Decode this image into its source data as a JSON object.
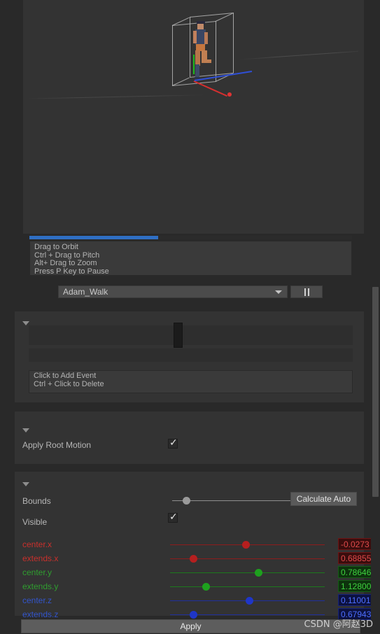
{
  "preview": {
    "hints": [
      "Drag to Orbit",
      "Ctrl + Drag to Pitch",
      "Alt+ Drag to Zoom",
      "Press P Key to Pause"
    ],
    "progress_percent": 40,
    "progress_color": "#2f6fc4"
  },
  "clip_selector": {
    "selected": "Adam_Walk",
    "play_pause_icon": "pause-icon"
  },
  "events": {
    "hints": [
      "Click to Add Event",
      "Ctrl + Click to Delete"
    ],
    "scrubber_percent": 46
  },
  "root_motion": {
    "label": "Apply Root Motion",
    "checked": true
  },
  "bounds": {
    "label": "Bounds",
    "slider_percent": 12,
    "calculate_auto_label": "Calculate Auto",
    "visible_label": "Visible",
    "visible_checked": true,
    "axes": [
      {
        "name": "center.x",
        "value": "-0.0273",
        "slider_percent": 49,
        "color": "#c9302c",
        "track": "#8e1c1c",
        "handle": "#b51f1f",
        "box_bg": "#3a0d0d",
        "box_border": "#6e1414",
        "text": "#e04b4b"
      },
      {
        "name": "extends.x",
        "value": "0.68855",
        "slider_percent": 15,
        "color": "#c9302c",
        "track": "#8e1c1c",
        "handle": "#b51f1f",
        "box_bg": "#3a0d0d",
        "box_border": "#6e1414",
        "text": "#e04b4b"
      },
      {
        "name": "center.y",
        "value": "0.78646",
        "slider_percent": 57,
        "color": "#2f9e2f",
        "track": "#1c7a1c",
        "handle": "#1ea11e",
        "box_bg": "#0d330d",
        "box_border": "#145e14",
        "text": "#3fd13f"
      },
      {
        "name": "extends.y",
        "value": "1.12800",
        "slider_percent": 23,
        "color": "#2f9e2f",
        "track": "#1c7a1c",
        "handle": "#1ea11e",
        "box_bg": "#0d330d",
        "box_border": "#145e14",
        "text": "#3fd13f"
      },
      {
        "name": "center.z",
        "value": "0.11001",
        "slider_percent": 51,
        "color": "#3355cc",
        "track": "#1f2f9e",
        "handle": "#1f36c8",
        "box_bg": "#0c1140",
        "box_border": "#16237a",
        "text": "#4d6fff"
      },
      {
        "name": "extends.z",
        "value": "0.67943",
        "slider_percent": 15,
        "color": "#3355cc",
        "track": "#1f2f9e",
        "handle": "#1f36c8",
        "box_bg": "#0c1140",
        "box_border": "#16237a",
        "text": "#4d6fff"
      }
    ]
  },
  "apply_button_label": "Apply",
  "watermark": "CSDN @阿赵3D"
}
